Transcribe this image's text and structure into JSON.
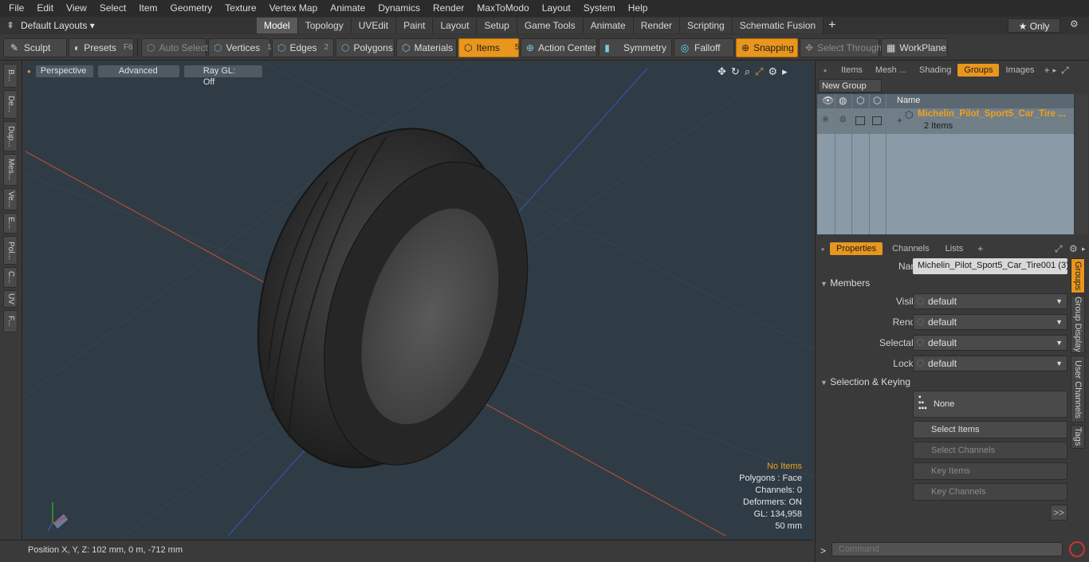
{
  "menu": [
    "File",
    "Edit",
    "View",
    "Select",
    "Item",
    "Geometry",
    "Texture",
    "Vertex Map",
    "Animate",
    "Dynamics",
    "Render",
    "MaxToModo",
    "Layout",
    "System",
    "Help"
  ],
  "layout_selector": "Default Layouts ▾",
  "layout_tabs": [
    {
      "label": "Model",
      "active": true
    },
    {
      "label": "Topology"
    },
    {
      "label": "UVEdit"
    },
    {
      "label": "Paint"
    },
    {
      "label": "Layout"
    },
    {
      "label": "Setup"
    },
    {
      "label": "Game Tools"
    },
    {
      "label": "Animate"
    },
    {
      "label": "Render"
    },
    {
      "label": "Scripting"
    },
    {
      "label": "Schematic Fusion"
    }
  ],
  "only_label": "★  Only",
  "toolbar": {
    "sculpt": "Sculpt",
    "presets": "Presets",
    "presets_key": "F6",
    "auto_select": "Auto Select",
    "vertices": "Vertices",
    "vertices_n": "1",
    "edges": "Edges",
    "edges_n": "2",
    "polygons": "Polygons",
    "materials": "Materials",
    "items": "Items",
    "items_n": "5",
    "action_center": "Action Center",
    "symmetry": "Symmetry",
    "falloff": "Falloff",
    "snapping": "Snapping",
    "select_through": "Select Through",
    "workplane": "WorkPlane"
  },
  "left_tabs": [
    "B...",
    "De...",
    "Dup...",
    "Mes...",
    "Ve...",
    "E...",
    "Pol...",
    "C...",
    "UV",
    "F..."
  ],
  "viewport": {
    "perspective": "Perspective",
    "advanced": "Advanced",
    "raygl": "Ray GL: Off",
    "info": {
      "no_items": "No Items",
      "polygons": "Polygons : Face",
      "channels": "Channels: 0",
      "deformers": "Deformers: ON",
      "gl": "GL: 134,958",
      "scale": "50 mm"
    }
  },
  "status": {
    "position": "Position X, Y, Z:  102 mm, 0 m, -712 mm"
  },
  "groups_panel": {
    "tabs": [
      {
        "label": "Items"
      },
      {
        "label": "Mesh ..."
      },
      {
        "label": "Shading"
      },
      {
        "label": "Groups",
        "active": true
      },
      {
        "label": "Images"
      }
    ],
    "new_group": "New Group",
    "col_name": "Name",
    "row_name": "Michelin_Pilot_Sport5_Car_Tire ...",
    "row_sub": "2 Items"
  },
  "properties": {
    "tabs": [
      {
        "label": "Properties",
        "active": true
      },
      {
        "label": "Channels"
      },
      {
        "label": "Lists"
      }
    ],
    "name_label": "Name",
    "name_value": "Michelin_Pilot_Sport5_Car_Tire001 (3)",
    "members": "Members",
    "visible_label": "Visible",
    "visible_value": "default",
    "render_label": "Render",
    "render_value": "default",
    "selectable_label": "Selectable",
    "selectable_value": "default",
    "locked_label": "Locked",
    "locked_value": "default",
    "sel_keying": "Selection & Keying",
    "none": "None",
    "select_items": "Select Items",
    "select_channels": "Select Channels",
    "key_items": "Key Items",
    "key_channels": "Key Channels",
    "more": ">>"
  },
  "side_tabs": [
    "Groups",
    "Group Display",
    "User Channels",
    "Tags"
  ],
  "command_placeholder": "Command",
  "colors": {
    "accent": "#e8961e",
    "viewport": "#2f3c45",
    "highlight_text": "#f0a020"
  }
}
